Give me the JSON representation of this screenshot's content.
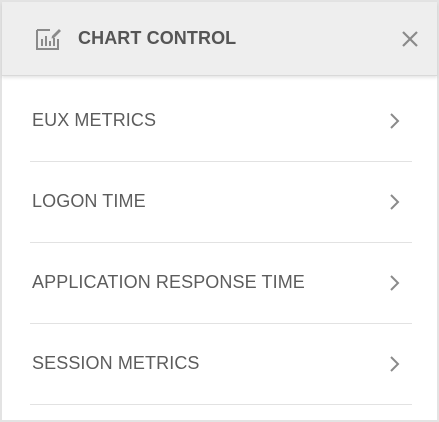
{
  "header": {
    "title": "CHART CONTROL",
    "icon": "chart-edit-icon",
    "close_icon": "close-icon"
  },
  "menu": {
    "items": [
      {
        "label": "EUX METRICS",
        "icon": "chevron-right-icon"
      },
      {
        "label": "LOGON TIME",
        "icon": "chevron-right-icon"
      },
      {
        "label": "APPLICATION RESPONSE TIME",
        "icon": "chevron-right-icon"
      },
      {
        "label": "SESSION METRICS",
        "icon": "chevron-right-icon"
      }
    ]
  },
  "colors": {
    "header_bg": "#eeeeee",
    "text": "#5c5c5c",
    "icon": "#8a8a8a",
    "divider": "#e2e2e2"
  }
}
